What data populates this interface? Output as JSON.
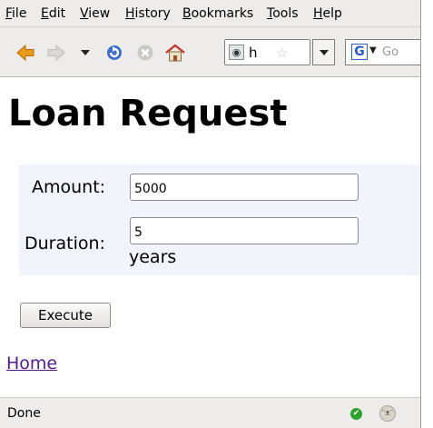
{
  "menubar": {
    "items": [
      "File",
      "Edit",
      "View",
      "History",
      "Bookmarks",
      "Tools",
      "Help"
    ]
  },
  "toolbar": {
    "icons": [
      "back-icon",
      "forward-icon",
      "history-dropdown-icon",
      "reload-icon",
      "stop-icon",
      "home-icon"
    ],
    "url": {
      "text": "h",
      "favicon": "page-icon"
    },
    "search": {
      "engine_glyph": "G",
      "placeholder": "Go"
    }
  },
  "page": {
    "title": "Loan Request",
    "form": {
      "amount_label": "Amount:",
      "amount_value": "5000",
      "duration_label": "Duration:",
      "duration_value": "5",
      "duration_unit": "years",
      "submit_label": "Execute"
    },
    "home_link": "Home"
  },
  "statusbar": {
    "text": "Done",
    "icons": [
      "secure-check-icon",
      "extension-face-icon"
    ]
  },
  "colors": {
    "chrome_bg": "#edeceb",
    "form_bg": "#f1f4fb",
    "visited_link": "#551a8b"
  }
}
